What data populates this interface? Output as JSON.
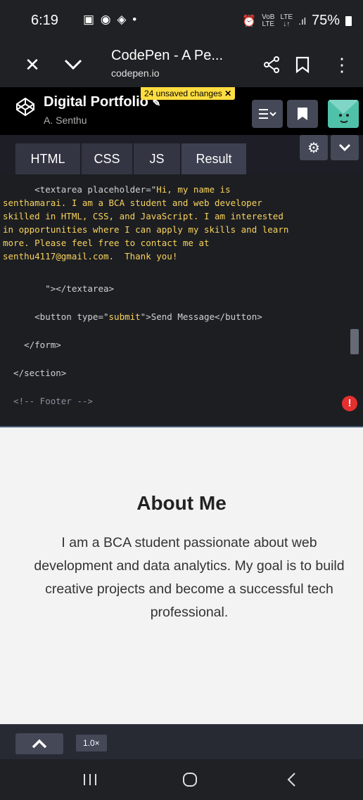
{
  "status": {
    "time": "6:19",
    "battery": "75%",
    "net_top": "VoB",
    "net_bottom": "LTE",
    "lte_top": "LTE",
    "lte_bottom": "↓↑"
  },
  "browser": {
    "title": "CodePen - A Pe...",
    "domain": "codepen.io"
  },
  "project": {
    "title": "Digital Portfolio",
    "author": "A. Senthu",
    "unsaved": "24 unsaved changes"
  },
  "tabs": [
    "HTML",
    "CSS",
    "JS",
    "Result"
  ],
  "code": {
    "l1a": "      <textarea placeholder=\"",
    "l1b": "Hi, my name is",
    "l2": "senthamarai. I am a BCA student and web developer",
    "l3": "skilled in HTML, CSS, and JavaScript. I am interested",
    "l4": "in opportunities where I can apply my skills and learn",
    "l5": "more. Please feel free to contact me at",
    "l6": "senthu4117@gmail.com.  Thank you!",
    "l7": "        \"></textarea>",
    "l8a": "      <button type=\"",
    "l8b": "submit",
    "l8c": "\">Send Message</button>",
    "l9": "    </form>",
    "l10": "  </section>",
    "l11": "  <!-- Footer -->"
  },
  "result": {
    "heading": "About Me",
    "text": "I am a BCA student passionate about web development and data analytics. My goal is to build creative projects and become a successful tech professional."
  },
  "console": {
    "zoom": "1.0×"
  }
}
